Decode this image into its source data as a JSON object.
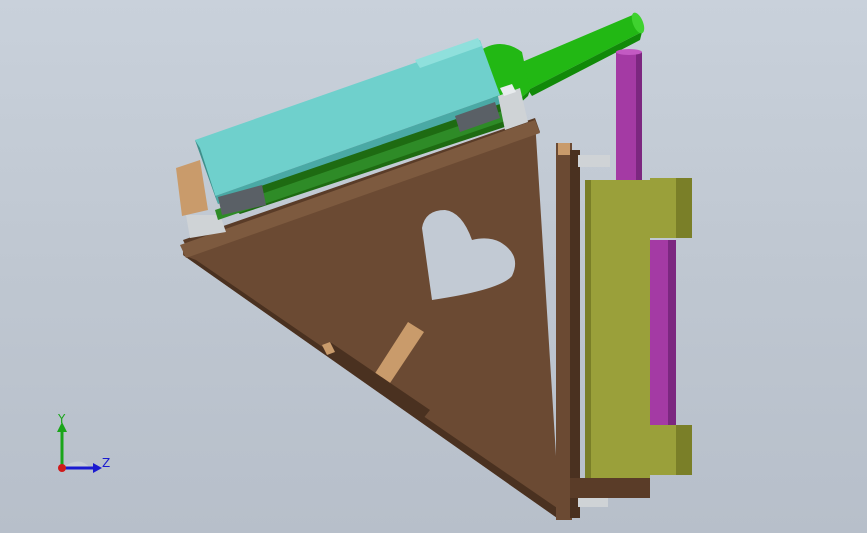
{
  "viewport": {
    "background_top": "#c9d1db",
    "background_bottom": "#b7bfca"
  },
  "model": {
    "colors": {
      "wood": "#6b4a33",
      "wood_dark": "#4a3120",
      "wood_light": "#c99b6b",
      "body_cyan": "#6fd0cc",
      "body_cyan_dark": "#4aa9a5",
      "cylinder_green": "#22b814",
      "cylinder_green_dark": "#118a09",
      "olive": "#9aa03a",
      "olive_dark": "#7a7f28",
      "purple": "#a43aa4",
      "purple_dark": "#7c2780",
      "steel": "#cfd3d6",
      "steel_dark": "#8e9398"
    },
    "icons": [
      "heart-cutout-icon"
    ]
  },
  "triad": {
    "y_label": "Y",
    "z_label": "Z",
    "y_color": "#1aa51a",
    "z_color": "#1a1ad0",
    "x_color": "#d01a1a"
  }
}
